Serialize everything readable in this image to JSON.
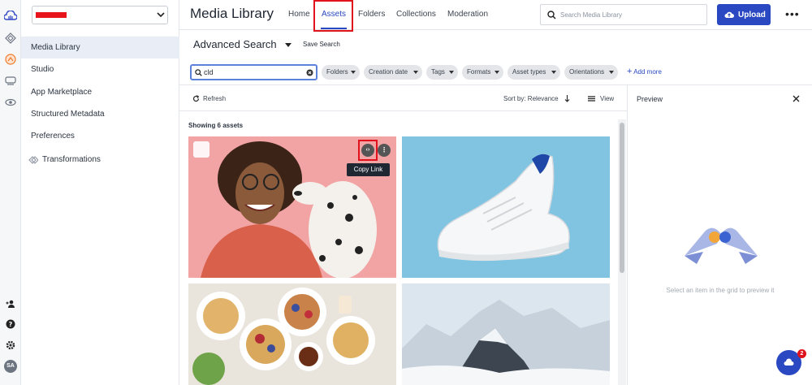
{
  "nav": {
    "items": [
      {
        "label": "Media Library",
        "active": true
      },
      {
        "label": "Studio"
      },
      {
        "label": "App Marketplace"
      },
      {
        "label": "Structured Metadata"
      },
      {
        "label": "Preferences"
      },
      {
        "label": "Transformations"
      }
    ]
  },
  "header": {
    "title": "Media Library",
    "tabs": [
      "Home",
      "Assets",
      "Folders",
      "Collections",
      "Moderation"
    ],
    "search_placeholder": "Search Media Library",
    "upload_label": "Upload"
  },
  "advanced": {
    "title": "Advanced Search",
    "save_label": "Save Search",
    "search_value": "cld",
    "filters": [
      "Folders",
      "Creation date",
      "Tags",
      "Formats",
      "Asset types",
      "Orientations"
    ],
    "add_more": "Add more"
  },
  "toolbar": {
    "refresh": "Refresh",
    "sort": "Sort by: Relevance",
    "view": "View"
  },
  "grid": {
    "count_text": "Showing 6 assets",
    "tooltip": "Copy Link"
  },
  "preview": {
    "title": "Preview",
    "empty_text": "Select an item in the grid to preview it"
  },
  "user": {
    "initials": "SA"
  },
  "chat": {
    "badge": "2"
  },
  "colors": {
    "accent": "#2948c1",
    "highlight": "#e0121b"
  }
}
